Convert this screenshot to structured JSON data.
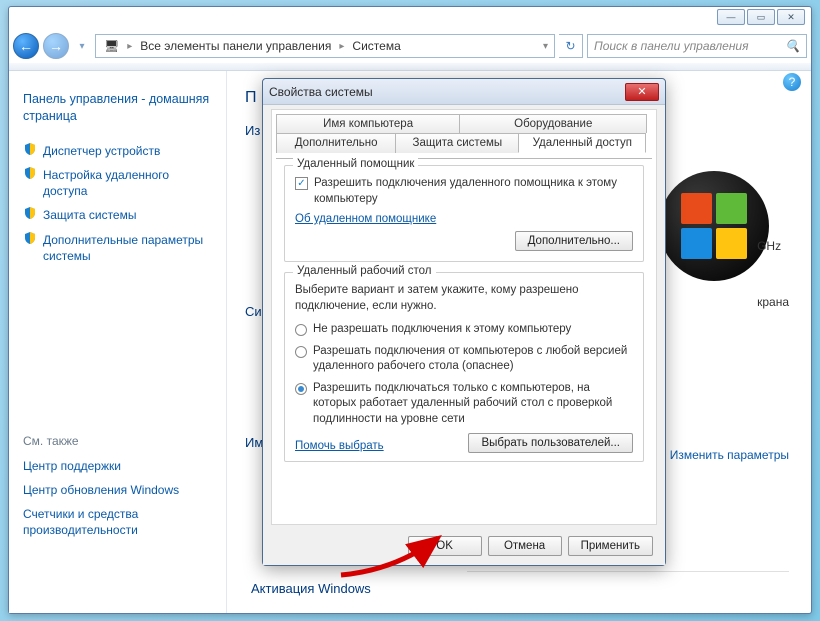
{
  "titlebar": {
    "min": "—",
    "max": "▭",
    "close": "✕"
  },
  "breadcrumb": {
    "seg1": "Все элементы панели управления",
    "seg2": "Система",
    "refresh": "↻"
  },
  "search": {
    "placeholder": "Поиск в панели управления"
  },
  "sidebar": {
    "home": "Панель управления - домашняя страница",
    "items": [
      {
        "label": "Диспетчер устройств"
      },
      {
        "label": "Настройка удаленного доступа"
      },
      {
        "label": "Защита системы"
      },
      {
        "label": "Дополнительные параметры системы"
      }
    ],
    "see_also": "См. также",
    "extras": [
      {
        "label": "Центр поддержки"
      },
      {
        "label": "Центр обновления Windows"
      },
      {
        "label": "Счетчики и средства производительности"
      }
    ]
  },
  "main": {
    "title_frag": "П",
    "row1": "Из",
    "row2": "Си",
    "row3": "Им",
    "ghz": "GHz",
    "ekrana": "крана",
    "settings_link": "Изменить параметры",
    "activation": "Активация Windows"
  },
  "dialog": {
    "title": "Свойства системы",
    "tabs": {
      "computer_name": "Имя компьютера",
      "hardware": "Оборудование",
      "advanced": "Дополнительно",
      "protection": "Защита системы",
      "remote": "Удаленный доступ"
    },
    "group_assist": {
      "legend": "Удаленный помощник",
      "checkbox_label": "Разрешить подключения удаленного помощника к этому компьютеру",
      "link": "Об удаленном помощнике",
      "btn": "Дополнительно..."
    },
    "group_desktop": {
      "legend": "Удаленный рабочий стол",
      "description": "Выберите вариант и затем укажите, кому разрешено подключение, если нужно.",
      "opt1": "Не разрешать подключения к этому компьютеру",
      "opt2": "Разрешать подключения от компьютеров с любой версией удаленного рабочего стола (опаснее)",
      "opt3": "Разрешить подключаться только с компьютеров, на которых работает удаленный рабочий стол с проверкой подлинности на уровне сети",
      "help_link": "Помочь выбрать",
      "select_users": "Выбрать пользователей..."
    },
    "buttons": {
      "ok": "OK",
      "cancel": "Отмена",
      "apply": "Применить"
    }
  }
}
